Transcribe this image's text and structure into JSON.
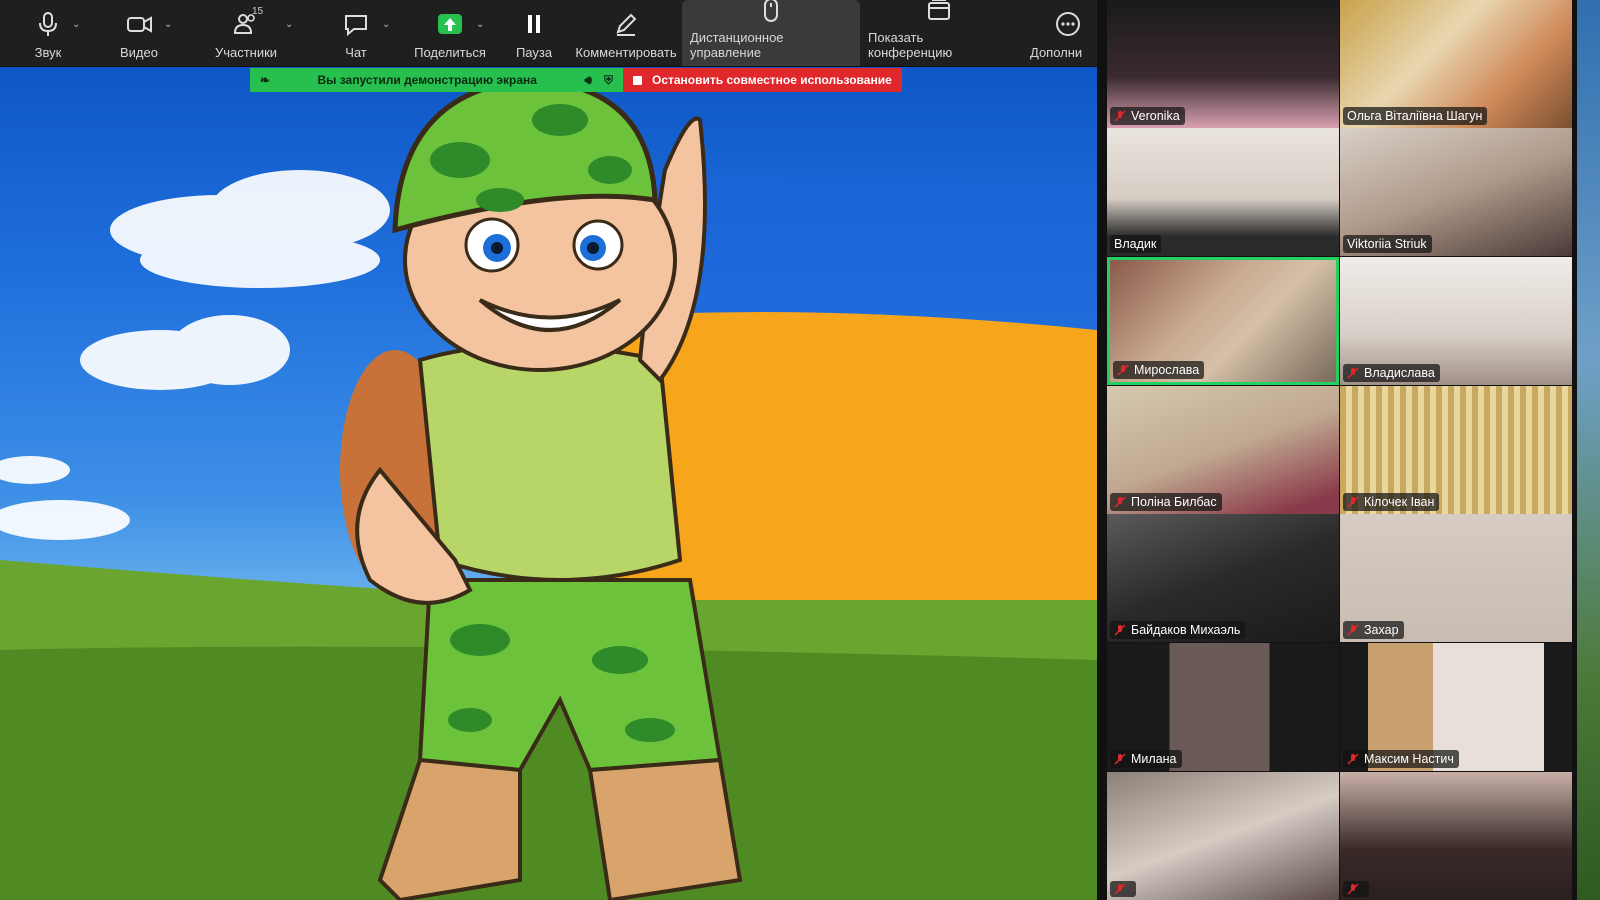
{
  "toolbar": {
    "items": [
      {
        "label": "Звук",
        "icon": "microphone-icon",
        "has_caret": true
      },
      {
        "label": "Видео",
        "icon": "video-camera-icon",
        "has_caret": true
      },
      {
        "label": "Участники",
        "icon": "participants-icon",
        "has_caret": true,
        "badge": "15"
      },
      {
        "label": "Чат",
        "icon": "chat-icon",
        "has_caret": true
      },
      {
        "label": "Поделиться",
        "icon": "share-screen-icon",
        "has_caret": true
      },
      {
        "label": "Пауза",
        "icon": "pause-icon",
        "has_caret": false
      },
      {
        "label": "Комментировать",
        "icon": "annotate-pencil-icon",
        "has_caret": false
      },
      {
        "label": "Дистанционное управление",
        "icon": "mouse-icon",
        "has_caret": false,
        "active": true
      },
      {
        "label": "Показать конференцию",
        "icon": "window-icon",
        "has_caret": false
      },
      {
        "label": "Дополни",
        "icon": "more-icon",
        "has_caret": false
      }
    ]
  },
  "share_banner": {
    "text": "Вы запустили демонстрацию экрана",
    "stop_label": "Остановить совместное использование",
    "color_share": "#27c04f",
    "color_stop": "#e0272b"
  },
  "participants": [
    {
      "name": "Veronika",
      "muted": true
    },
    {
      "name": "Ольга Віталіївна Шагун",
      "muted": false
    },
    {
      "name": "Владик",
      "muted": false
    },
    {
      "name": "Viktoriia Striuk",
      "muted": false
    },
    {
      "name": "Мирослава",
      "muted": true,
      "speaking": true
    },
    {
      "name": "Владислава",
      "muted": true
    },
    {
      "name": "Поліна Билбас",
      "muted": true
    },
    {
      "name": "Кілочек Іван",
      "muted": true
    },
    {
      "name": "Байдаков Михаэль",
      "muted": true
    },
    {
      "name": "Захар",
      "muted": true
    },
    {
      "name": "Милана",
      "muted": true
    },
    {
      "name": "Максим Настич",
      "muted": true
    },
    {
      "name": "",
      "muted": true
    },
    {
      "name": "",
      "muted": true
    }
  ],
  "colors": {
    "speaking_border": "#23d160",
    "toolbar_bg": "#1f1f1f"
  }
}
